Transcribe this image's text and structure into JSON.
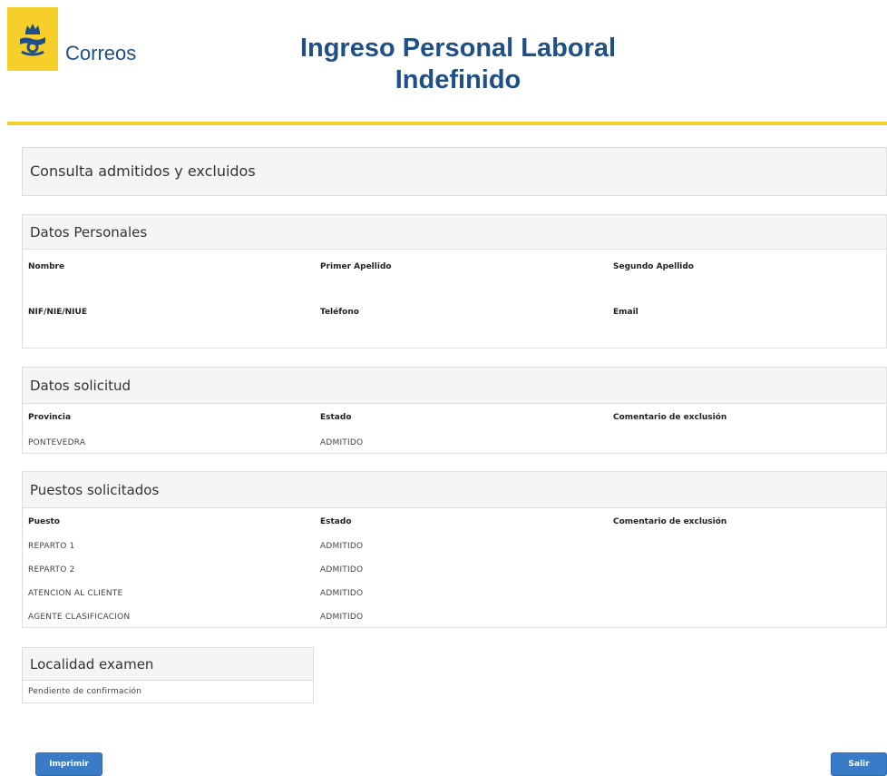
{
  "header": {
    "brand": "Correos",
    "title_line1": "Ingreso Personal Laboral",
    "title_line2": "Indefinido",
    "logo_icon": "correos-horn-crown-icon",
    "accent_color": "#f6cf2a",
    "brand_color": "#1f4f87"
  },
  "page_heading": "Consulta admitidos y excluidos",
  "personal": {
    "title": "Datos Personales",
    "labels": {
      "nombre": "Nombre",
      "primer_apellido": "Primer Apellido",
      "segundo_apellido": "Segundo Apellido",
      "nif": "NIF/NIE/NIUE",
      "telefono": "Teléfono",
      "email": "Email"
    }
  },
  "solicitud": {
    "title": "Datos solicitud",
    "labels": {
      "provincia": "Provincia",
      "estado": "Estado",
      "comentario": "Comentario de exclusión"
    },
    "values": {
      "provincia": "PONTEVEDRA",
      "estado": "ADMITIDO",
      "comentario": ""
    }
  },
  "puestos": {
    "title": "Puestos solicitados",
    "labels": {
      "puesto": "Puesto",
      "estado": "Estado",
      "comentario": "Comentario de exclusión"
    },
    "rows": [
      {
        "puesto": "REPARTO 1",
        "estado": "ADMITIDO"
      },
      {
        "puesto": "REPARTO 2",
        "estado": "ADMITIDO"
      },
      {
        "puesto": "ATENCION AL CLIENTE",
        "estado": "ADMITIDO"
      },
      {
        "puesto": "AGENTE CLASIFICACION",
        "estado": "ADMITIDO"
      }
    ]
  },
  "localidad": {
    "title": "Localidad examen",
    "value": "Pendiente de confirmación"
  },
  "buttons": {
    "imprimir": "Imprimir",
    "salir": "Salir",
    "button_color": "#3a7bc8"
  }
}
